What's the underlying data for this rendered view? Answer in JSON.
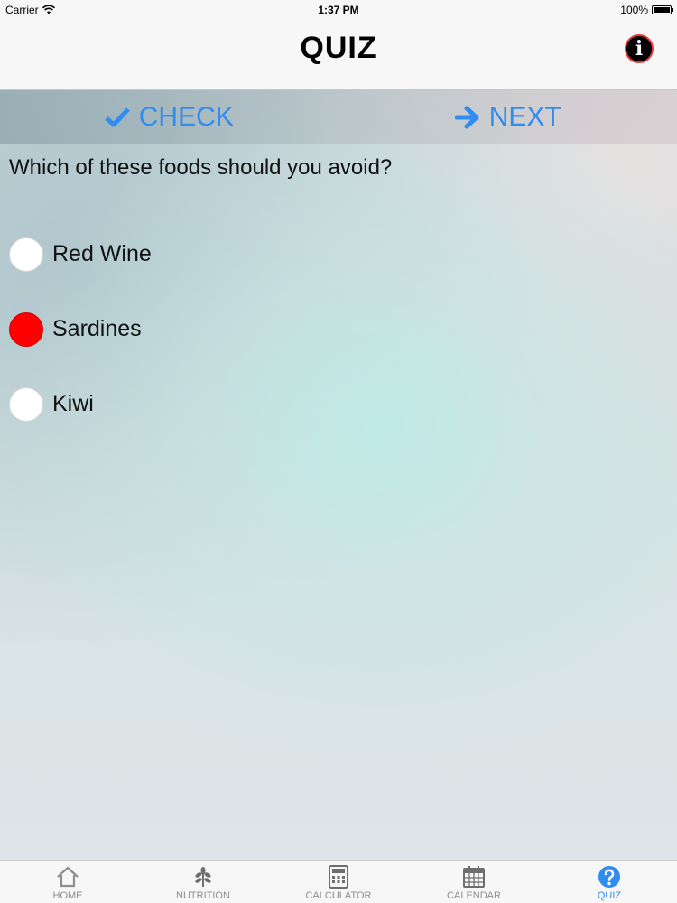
{
  "status_bar": {
    "carrier": "Carrier",
    "time": "1:37 PM",
    "battery": "100%"
  },
  "nav": {
    "title": "QUIZ",
    "info_icon": "info-icon"
  },
  "toolbar": {
    "check_label": "CHECK",
    "next_label": "NEXT",
    "accent_color": "#2f8cf0"
  },
  "quiz": {
    "question": "Which of these foods should you avoid?",
    "options": [
      {
        "label": "Red Wine",
        "selected": false
      },
      {
        "label": "Sardines",
        "selected": true
      },
      {
        "label": "Kiwi",
        "selected": false
      }
    ],
    "selected_color": "#ff0000"
  },
  "tab_bar": {
    "items": [
      {
        "label": "HOME",
        "icon": "home-icon",
        "active": false
      },
      {
        "label": "NUTRITION",
        "icon": "leaf-icon",
        "active": false
      },
      {
        "label": "CALCULATOR",
        "icon": "calculator-icon",
        "active": false
      },
      {
        "label": "CALENDAR",
        "icon": "calendar-icon",
        "active": false
      },
      {
        "label": "QUIZ",
        "icon": "question-icon",
        "active": true
      }
    ]
  }
}
